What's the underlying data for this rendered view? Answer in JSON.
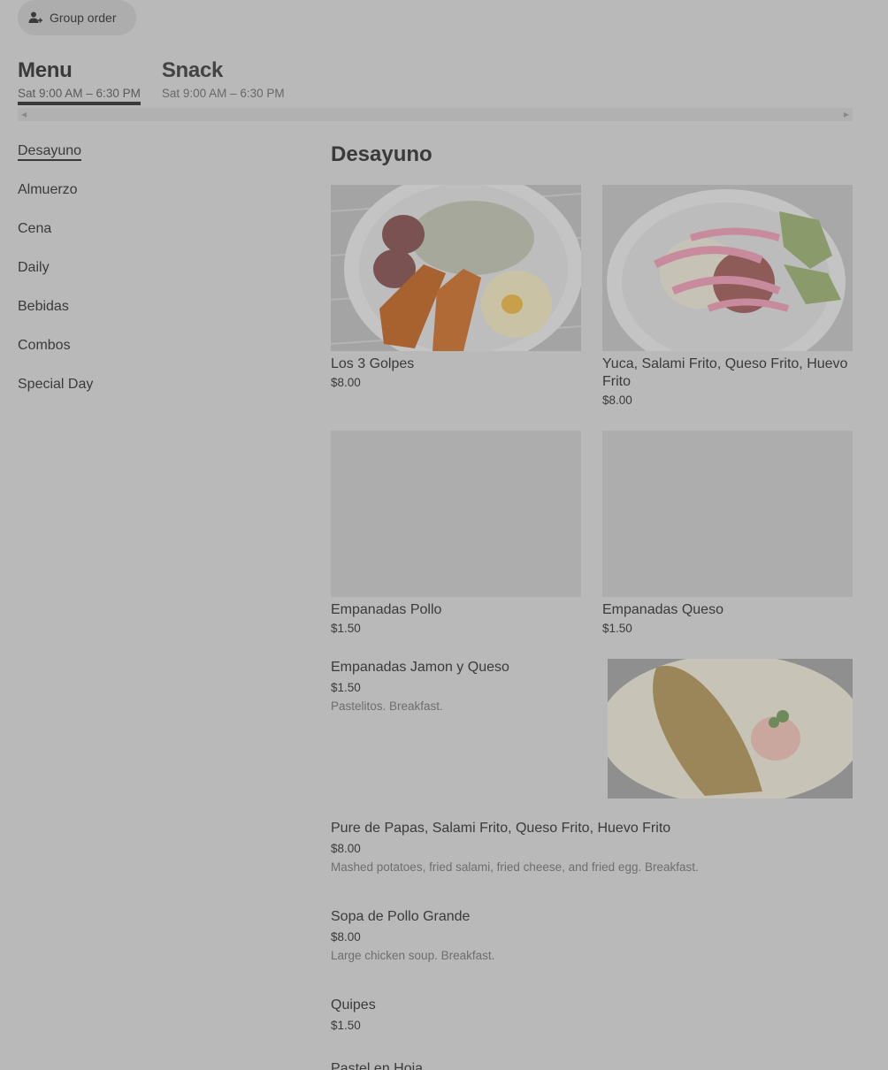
{
  "group_order": {
    "label": "Group order",
    "icon": "person-add-icon"
  },
  "menus": [
    {
      "title": "Menu",
      "hours": "Sat 9:00 AM – 6:30 PM",
      "active": true
    },
    {
      "title": "Snack",
      "hours": "Sat 9:00 AM – 6:30 PM",
      "active": false
    }
  ],
  "categories": [
    "Desayuno",
    "Almuerzo",
    "Cena",
    "Daily",
    "Bebidas",
    "Combos",
    "Special Day"
  ],
  "section": {
    "title": "Desayuno"
  },
  "cards": [
    {
      "name": "Los 3 Golpes",
      "price": "$8.00"
    },
    {
      "name": "Yuca, Salami Frito, Queso Frito, Huevo Frito",
      "price": "$8.00"
    },
    {
      "name": "Empanadas Pollo",
      "price": "$1.50"
    },
    {
      "name": "Empanadas Queso",
      "price": "$1.50"
    }
  ],
  "rows": [
    {
      "name": "Empanadas Jamon y Queso",
      "price": "$1.50",
      "desc": "Pastelitos. Breakfast."
    },
    {
      "name": "Pure de Papas, Salami Frito, Queso Frito, Huevo Frito",
      "price": "$8.00",
      "desc": "Mashed potatoes, fried salami, fried cheese, and fried egg. Breakfast."
    },
    {
      "name": "Sopa de Pollo Grande",
      "price": "$8.00",
      "desc": "Large chicken soup. Breakfast."
    },
    {
      "name": "Quipes",
      "price": "$1.50",
      "desc": ""
    },
    {
      "name": "Pastel en Hoja",
      "price": "",
      "desc": ""
    }
  ]
}
